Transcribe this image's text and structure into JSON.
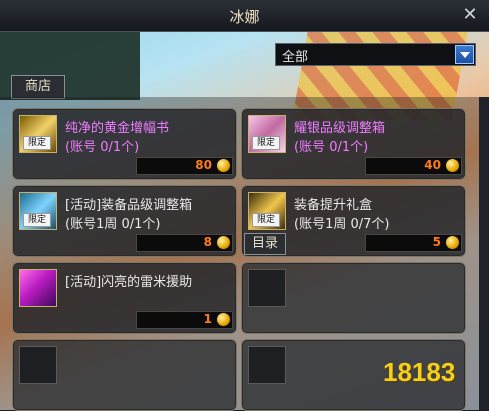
{
  "window": {
    "title": "冰娜"
  },
  "filter": {
    "selected": "全部"
  },
  "tabs": {
    "shop": "商店",
    "catalog": "目录"
  },
  "colors": {
    "pink_name": "#f07cff",
    "white_name": "#e9e9e9",
    "price": "#ff7a1a"
  },
  "items": [
    {
      "name": "纯净的黄金增幅书",
      "limit": "(账号 0/1个)",
      "price": "80",
      "tag": "限定",
      "name_color": "#f07cff",
      "icon": "gold-book-icon"
    },
    {
      "name": "耀银品级调整箱",
      "limit": "(账号 0/1个)",
      "price": "40",
      "tag": "限定",
      "name_color": "#f07cff",
      "icon": "silver-box-icon"
    },
    {
      "name": "[活动]装备品级调整箱",
      "limit": "(账号1周 0/1个)",
      "price": "8",
      "tag": "限定",
      "name_color": "#e9e9e9",
      "icon": "equipment-box-icon"
    },
    {
      "name": "装备提升礼盒",
      "limit": "(账号1周 0/7个)",
      "price": "5",
      "tag": "限定",
      "name_color": "#e9e9e9",
      "icon": "gift-box-icon"
    },
    {
      "name": "[活动]闪亮的雷米援助",
      "limit": "",
      "price": "1",
      "tag": "",
      "name_color": "#e9e9e9",
      "icon": "sparkle-icon"
    }
  ],
  "watermark": "18183"
}
